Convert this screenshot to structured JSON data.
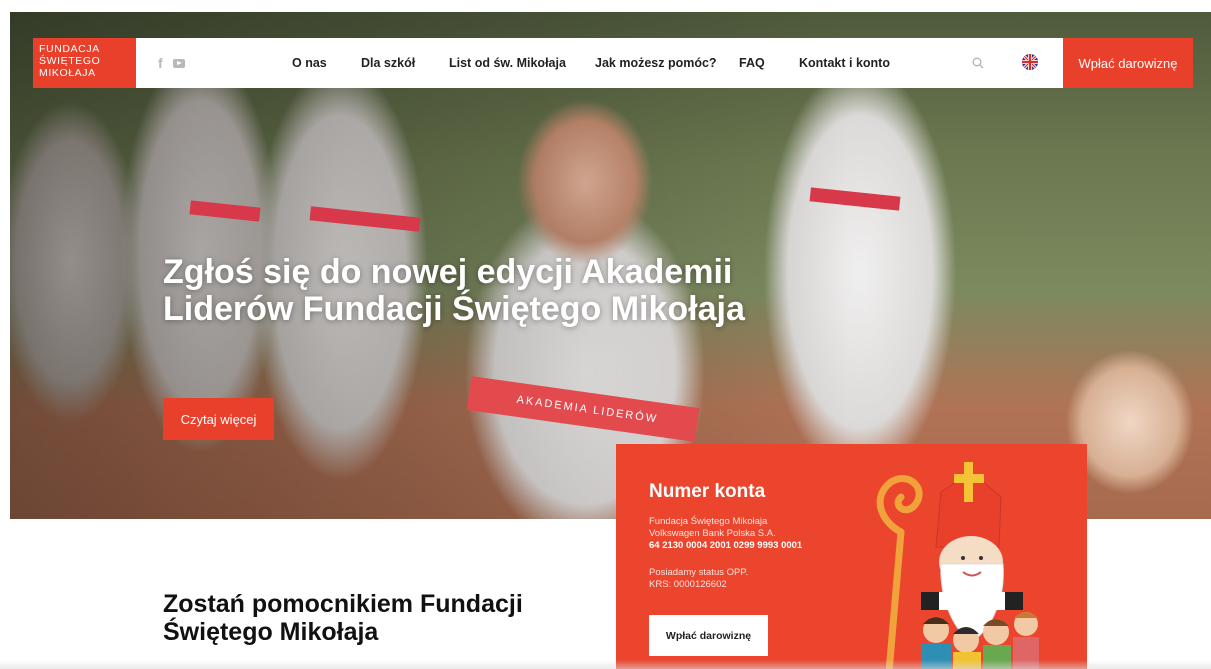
{
  "header": {
    "logo_line1": "Fundacja",
    "logo_line2": "Świętego",
    "logo_line3": "Mikołaja",
    "nav": [
      {
        "label": "O nas"
      },
      {
        "label": "Dla szkół"
      },
      {
        "label": "List od św. Mikołaja"
      },
      {
        "label": "Jak możesz pomóc?"
      },
      {
        "label": "FAQ"
      },
      {
        "label": "Kontakt i konto"
      }
    ],
    "donate_label": "Wpłać darowiznę",
    "social_icons": [
      "facebook-icon",
      "youtube-icon"
    ],
    "language_flag": "uk-flag-icon"
  },
  "hero": {
    "title": "Zgłoś się do nowej edycji Akademii Liderów Fundacji Świętego Mikołaja",
    "button_label": "Czytaj więcej",
    "shirt_text": "AKADEMIA LIDERÓW"
  },
  "account_card": {
    "title": "Numer konta",
    "line1": "Fundacja Świętego Mikołaja",
    "line2": "Volkswagen Bank Polska S.A.",
    "account_number": "64 2130 0004 2001 0299 9993 0001",
    "status": "Posiadamy status OPP.",
    "krs": "KRS: 0000126602",
    "button_label": "Wpłać darowiznę"
  },
  "section": {
    "title": "Zostań pomocnikiem Fundacji Świętego Mikołaja"
  },
  "colors": {
    "accent": "#e8402a",
    "card": "#ec452d"
  }
}
